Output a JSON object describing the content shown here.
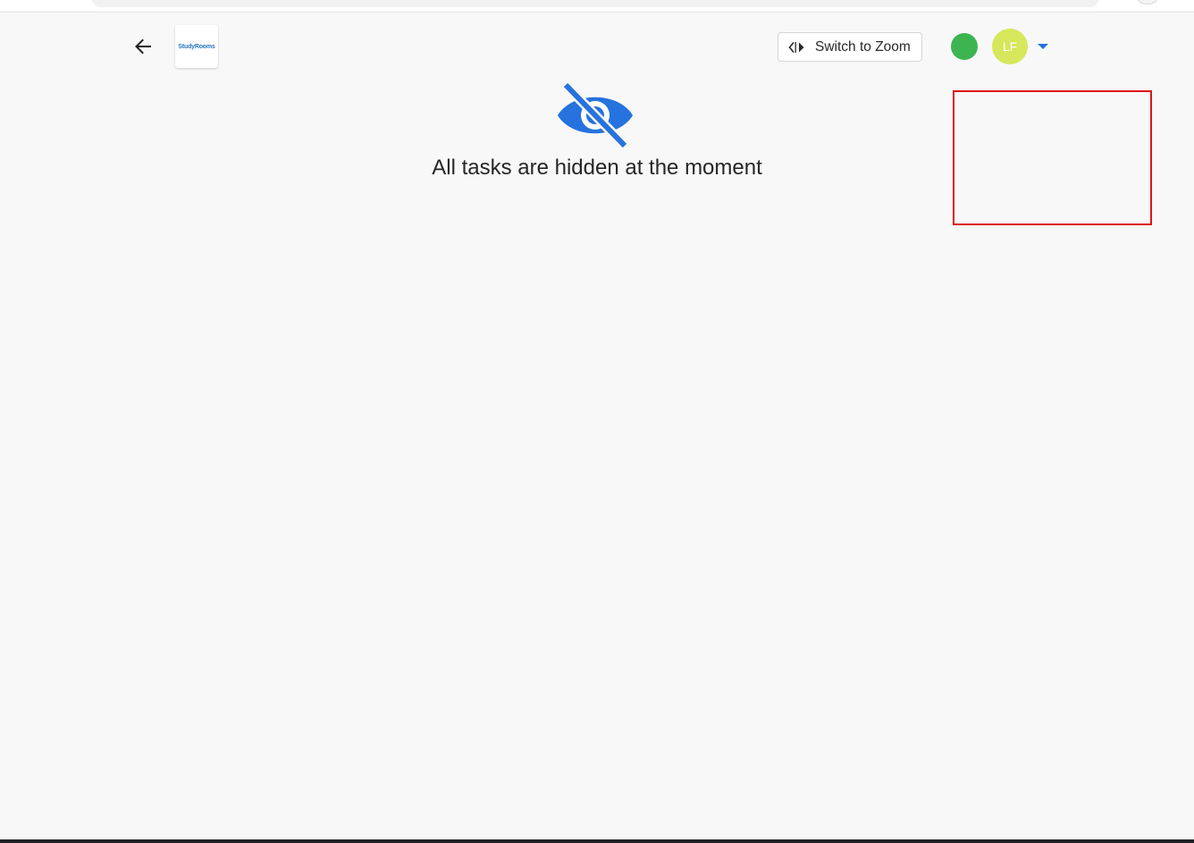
{
  "header": {
    "logo_text": "StudyRooms",
    "switch_button_label": "Switch to Zoom",
    "avatar_initials": "LF"
  },
  "empty_state": {
    "message": "All tasks are hidden at the moment"
  },
  "colors": {
    "accent": "#2672de",
    "online": "#3cb551",
    "avatar": "#d6e75c",
    "highlight": "#df1414",
    "background": "#f8f8f8"
  },
  "icons": {
    "back": "arrow-left-icon",
    "switch": "switch-arrows-icon",
    "hidden": "eye-off-icon",
    "caret": "caret-down-icon"
  }
}
